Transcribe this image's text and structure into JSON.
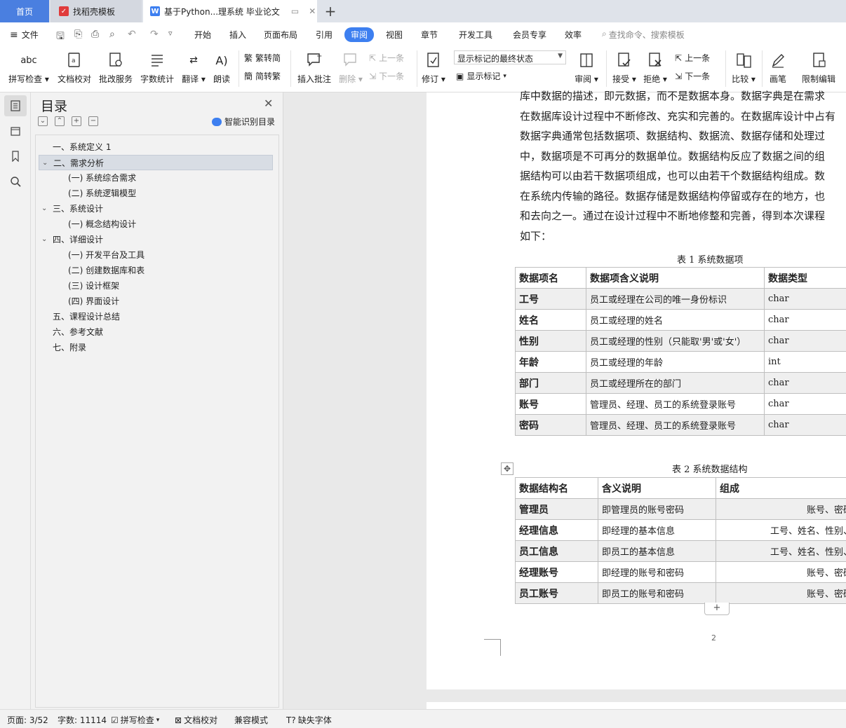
{
  "tabs": {
    "home": "首页",
    "templates": "找稻壳模板",
    "document": "基于Python...理系统 毕业论文"
  },
  "menu": {
    "file": "文件",
    "items": [
      "开始",
      "插入",
      "页面布局",
      "引用",
      "审阅",
      "视图",
      "章节",
      "开发工具",
      "会员专享",
      "效率"
    ],
    "active": "审阅",
    "search": "查找命令、搜索模板"
  },
  "ribbon": {
    "spell_check": "拼写检查",
    "doc_proof": "文档校对",
    "annotate_service": "批改服务",
    "word_count": "字数统计",
    "translate": "翻译",
    "read_aloud": "朗读",
    "trad_to_simp": "繁转简",
    "simp_to_trad": "简转繁",
    "insert_comment": "插入批注",
    "delete": "删除",
    "prev_comment": "上一条",
    "next_comment": "下一条",
    "track_changes": "修订",
    "markup_state": "显示标记的最终状态",
    "show_markup": "显示标记",
    "review": "审阅",
    "accept": "接受",
    "reject": "拒绝",
    "prev_change": "上一条",
    "next_change": "下一条",
    "compare": "比较",
    "pen": "画笔",
    "restrict_edit": "限制编辑",
    "abc": "abc"
  },
  "toc": {
    "title": "目录",
    "smart_toc": "智能识别目录",
    "items": [
      {
        "text": "一、系统定义 1",
        "level": 1,
        "arrow": ""
      },
      {
        "text": "二、需求分析",
        "level": 1,
        "arrow": "v"
      },
      {
        "text": "(一) 系统综合需求",
        "level": 2,
        "arrow": ""
      },
      {
        "text": "(二) 系统逻辑模型",
        "level": 2,
        "arrow": ""
      },
      {
        "text": "三、系统设计",
        "level": 1,
        "arrow": "v"
      },
      {
        "text": "(一) 概念结构设计",
        "level": 2,
        "arrow": ""
      },
      {
        "text": "四、详细设计",
        "level": 1,
        "arrow": "v"
      },
      {
        "text": "(一) 开发平台及工具",
        "level": 2,
        "arrow": ""
      },
      {
        "text": "(二) 创建数据库和表",
        "level": 2,
        "arrow": ""
      },
      {
        "text": "(三) 设计框架",
        "level": 2,
        "arrow": ""
      },
      {
        "text": "(四) 界面设计",
        "level": 2,
        "arrow": ""
      },
      {
        "text": "五、课程设计总结",
        "level": 1,
        "arrow": ""
      },
      {
        "text": "六、参考文献",
        "level": 1,
        "arrow": ""
      },
      {
        "text": "七、附录",
        "level": 1,
        "arrow": ""
      }
    ]
  },
  "document": {
    "paragraph_lines": [
      "库中数据的描述，即元数据，而不是数据本身。数据字典是在需求",
      "在数据库设计过程中不断修改、充实和完善的。在数据库设计中占有",
      "数据字典通常包括数据项、数据结构、数据流、数据存储和处理过",
      "中，数据项是不可再分的数据单位。数据结构反应了数据之间的组",
      "据结构可以由若干数据项组成，也可以由若干个数据结构组成。数",
      "在系统内传输的路径。数据存储是数据结构停留或存在的地方，也",
      "和去向之一。通过在设计过程中不断地修整和完善，得到本次课程",
      "如下："
    ],
    "table1": {
      "caption": "表 1  系统数据项",
      "headers": [
        "数据项名",
        "数据项含义说明",
        "数据类型"
      ],
      "rows": [
        [
          "工号",
          "员工或经理在公司的唯一身份标识",
          "char"
        ],
        [
          "姓名",
          "员工或经理的姓名",
          "char"
        ],
        [
          "性别",
          "员工或经理的性别（只能取'男'或'女'）",
          "char"
        ],
        [
          "年龄",
          "员工或经理的年龄",
          "int"
        ],
        [
          "部门",
          "员工或经理所在的部门",
          "char"
        ],
        [
          "账号",
          "管理员、经理、员工的系统登录账号",
          "char"
        ],
        [
          "密码",
          "管理员、经理、员工的系统登录账号",
          "char"
        ]
      ]
    },
    "table2": {
      "caption": "表 2  系统数据结构",
      "headers": [
        "数据结构名",
        "含义说明",
        "组成"
      ],
      "rows": [
        [
          "管理员",
          "即管理员的账号密码",
          "账号、密码"
        ],
        [
          "经理信息",
          "即经理的基本信息",
          "工号、姓名、性别、"
        ],
        [
          "员工信息",
          "即员工的基本信息",
          "工号、姓名、性别、"
        ],
        [
          "经理账号",
          "即经理的账号和密码",
          "账号、密码"
        ],
        [
          "员工账号",
          "即员工的账号和密码",
          "账号、密码"
        ]
      ]
    },
    "page_number": "2",
    "add_row": "+"
  },
  "status": {
    "page": "页面: 3/52",
    "words": "字数: 11114",
    "spell_check": "拼写检查",
    "doc_proof": "文档校对",
    "compat_mode": "兼容模式",
    "missing_fonts": "缺失字体"
  },
  "colors": {
    "accent": "#3d7ff0",
    "home_tab": "#4a7fe0"
  }
}
